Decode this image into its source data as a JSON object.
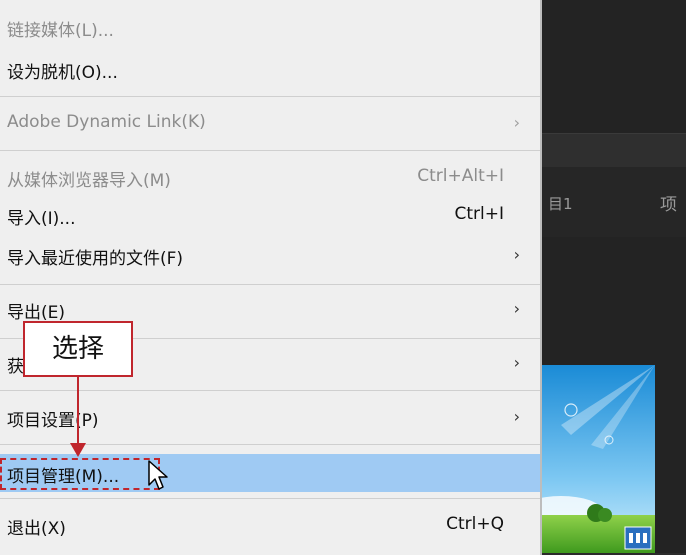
{
  "menu": {
    "items": [
      {
        "label": "链接媒体(L)...",
        "shortcut": "",
        "disabled": true
      },
      {
        "label": "设为脱机(O)...",
        "shortcut": "",
        "disabled": false
      },
      {
        "label": "Adobe Dynamic Link(K)",
        "shortcut": "",
        "disabled": true
      },
      {
        "label": "从媒体浏览器导入(M)",
        "shortcut": "Ctrl+Alt+I",
        "disabled": true
      },
      {
        "label": "导入(I)...",
        "shortcut": "Ctrl+I",
        "disabled": false
      },
      {
        "label": "导入最近使用的文件(F)",
        "shortcut": "",
        "disabled": false
      },
      {
        "label": "导出(E)",
        "shortcut": "",
        "disabled": false
      },
      {
        "label": "获取属性(G)",
        "shortcut": "",
        "disabled": false
      },
      {
        "label": "项目设置(P)",
        "shortcut": "",
        "disabled": false
      },
      {
        "label": "项目管理(M)...",
        "shortcut": "",
        "disabled": false
      },
      {
        "label": "退出(X)",
        "shortcut": "Ctrl+Q",
        "disabled": false
      }
    ],
    "submenu_arrow": "›"
  },
  "annotation": {
    "text": "选择"
  },
  "background": {
    "label1": "目1",
    "label2": "项"
  },
  "colors": {
    "highlight": "#9fcaf3",
    "annotation": "#c0262d",
    "menu_bg": "#efefef"
  }
}
